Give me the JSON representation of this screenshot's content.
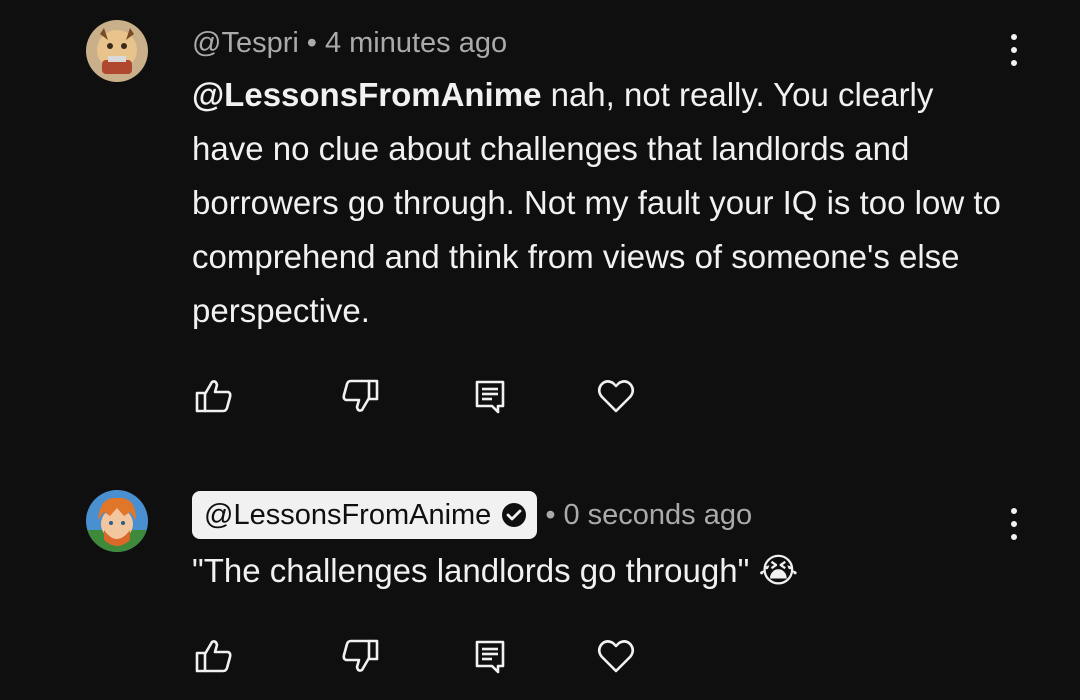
{
  "comments": [
    {
      "author": "@Tespri",
      "separator": "•",
      "time": "4 minutes ago",
      "mention": "@LessonsFromAnime",
      "text": " nah, not really. You clearly have no clue about challenges that landlords and borrowers go through. Not my fault your IQ is too low to comprehend and think from views of someone's else perspective.",
      "avatar_icon": "cartoon-avatar",
      "actions": [
        "like",
        "dislike",
        "reply",
        "heart"
      ]
    },
    {
      "author": "@LessonsFromAnime",
      "verified": true,
      "separator": "•",
      "time": "0 seconds ago",
      "text": "\"The challenges landlords go through\" ",
      "emoji": "😭",
      "avatar_icon": "anime-character-avatar",
      "actions": [
        "like",
        "dislike",
        "reply",
        "heart"
      ]
    }
  ],
  "colors": {
    "background": "#0f0f0f",
    "text": "#f1f1f1",
    "meta": "#aaaaaa"
  }
}
